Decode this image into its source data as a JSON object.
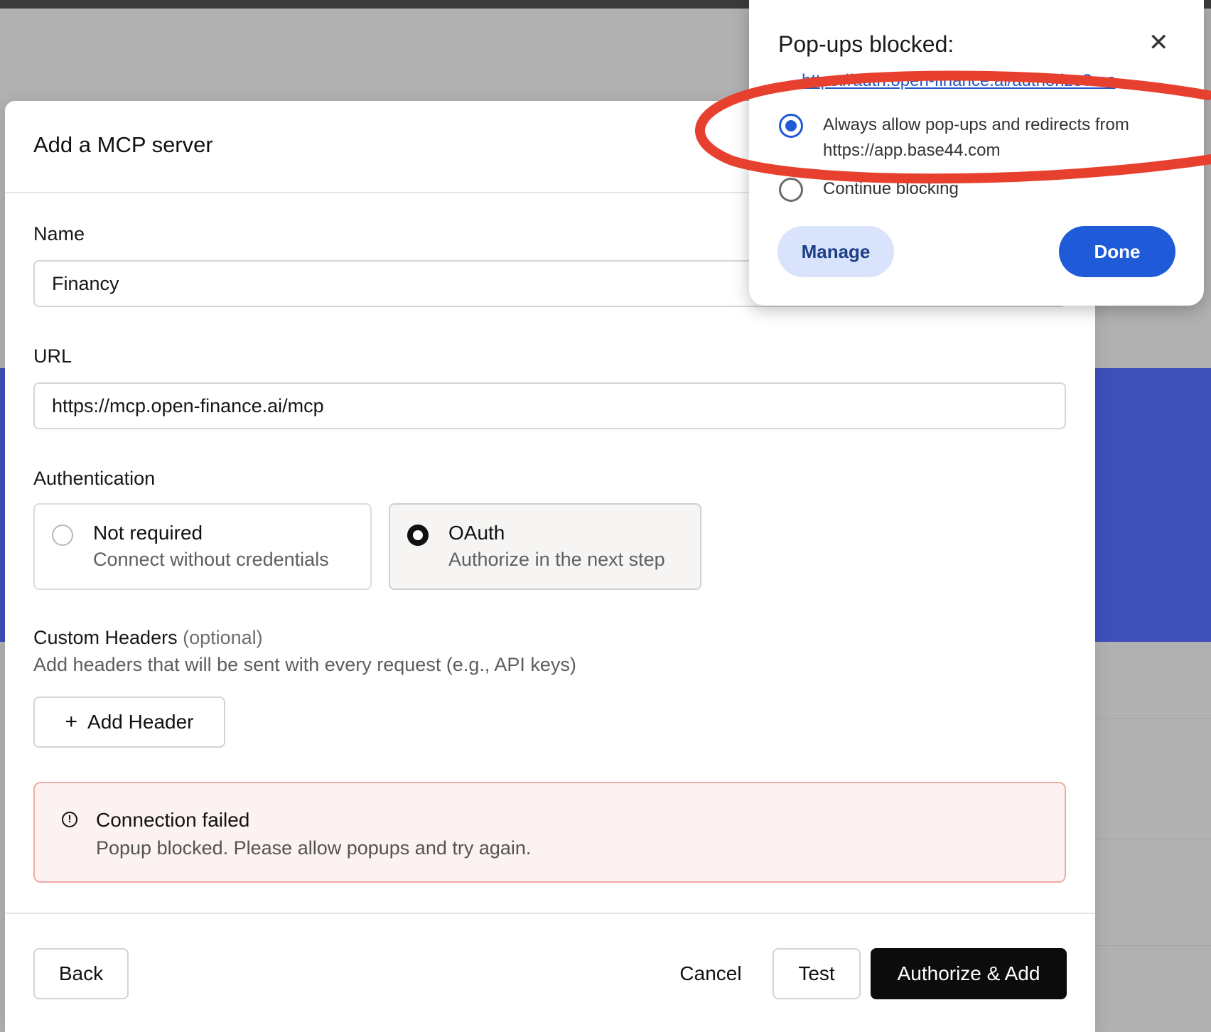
{
  "modal": {
    "title": "Add a MCP server",
    "name_label": "Name",
    "name_value": "Financy",
    "url_label": "URL",
    "url_value": "https://mcp.open-finance.ai/mcp",
    "auth_label": "Authentication",
    "auth_options": [
      {
        "title": "Not required",
        "subtitle": "Connect without credentials",
        "selected": false
      },
      {
        "title": "OAuth",
        "subtitle": "Authorize in the next step",
        "selected": true
      }
    ],
    "headers_label": "Custom Headers",
    "headers_optional": "(optional)",
    "headers_helper": "Add headers that will be sent with every request (e.g., API keys)",
    "add_header_button": "Add Header",
    "add_header_icon": "+",
    "alert": {
      "icon": "!",
      "title": "Connection failed",
      "message": "Popup blocked. Please allow popups and try again.",
      "color": "#f0aaa6"
    },
    "footer": {
      "back": "Back",
      "cancel": "Cancel",
      "test": "Test",
      "authorize": "Authorize & Add"
    }
  },
  "popup": {
    "title": "Pop-ups blocked:",
    "close_icon": "✕",
    "blocked_link": "https://auth.open-finance.ai/authorize?res",
    "options": [
      {
        "line1": "Always allow pop-ups and redirects from",
        "line2": "https://app.base44.com",
        "selected": true
      },
      {
        "line1": "Continue blocking",
        "selected": false
      }
    ],
    "manage_button": "Manage",
    "done_button": "Done",
    "accent_color": "#1f5ad8"
  },
  "annotation": {
    "color": "#e8402e"
  }
}
